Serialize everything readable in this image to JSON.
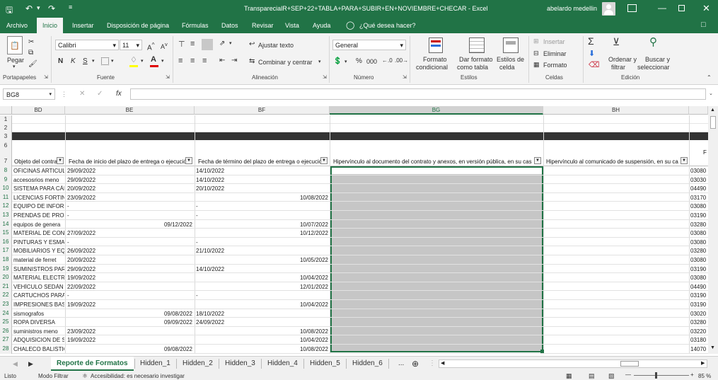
{
  "titlebar": {
    "save_icon": "save-icon",
    "undo_icon": "undo-icon",
    "redo_icon": "redo-icon",
    "customize_icon": "customize-qat-icon",
    "title": "TransparecialR+SEP+22+TABLA+PARA+SUBIR+EN+NOVIEMBRE+CHECAR  -  Excel",
    "user": "abelardo medellin",
    "ribbon_display_icon": "ribbon-display-icon",
    "minimize_icon": "minimize-icon",
    "restore_icon": "restore-icon",
    "close_icon": "close-icon"
  },
  "menu": {
    "items": [
      "Archivo",
      "Inicio",
      "Insertar",
      "Disposición de página",
      "Fórmulas",
      "Datos",
      "Revisar",
      "Vista",
      "Ayuda"
    ],
    "active": "Inicio",
    "tell_me": "¿Qué desea hacer?",
    "comments_icon": "comment-icon"
  },
  "ribbon": {
    "clipboard": {
      "paste": "Pegar",
      "label": "Portapapeles"
    },
    "font": {
      "name": "Calibri",
      "size": "11",
      "bold": "N",
      "italic": "K",
      "underline": "S",
      "label": "Fuente"
    },
    "alignment": {
      "wrap": "Ajustar texto",
      "merge": "Combinar y centrar",
      "label": "Alineación"
    },
    "number": {
      "format": "General",
      "percent": "%",
      "thousands": "000",
      "label": "Número"
    },
    "styles": {
      "conditional": [
        "Formato",
        "condicional"
      ],
      "table": [
        "Dar formato",
        "como tabla"
      ],
      "cell": [
        "Estilos de",
        "celda"
      ],
      "label": "Estilos"
    },
    "cells": {
      "insert": "Insertar",
      "delete": "Eliminar",
      "format": "Formato",
      "label": "Celdas"
    },
    "editing": {
      "sort": [
        "Ordenar y",
        "filtrar"
      ],
      "find": [
        "Buscar y",
        "seleccionar"
      ],
      "label": "Edición"
    }
  },
  "formula_bar": {
    "name_box": "BG8",
    "fx": "fx",
    "value": ""
  },
  "columns": [
    {
      "letter": "BD"
    },
    {
      "letter": "BE"
    },
    {
      "letter": "BF"
    },
    {
      "letter": "BG"
    },
    {
      "letter": "BH"
    }
  ],
  "header_row": {
    "row_number": "7",
    "cells": [
      "Objeto del contra",
      "Fecha de inicio del plazo de entrega o ejecució",
      "Fecha de término del plazo de entrega o ejecució",
      "Hipervínculo al documento del contrato y anexos, en versión pública, en su cas",
      "Hipervínculo al comunicado de suspensión, en su ca"
    ],
    "last_partial": "F"
  },
  "top_rows": [
    "1",
    "2",
    "3",
    "6"
  ],
  "rows": [
    {
      "n": "8",
      "bd": "OFICINAS ARTICULO",
      "be": "29/09/2022",
      "be_r": "",
      "bf": "14/10/2022",
      "bf_r": "",
      "bi": "03080"
    },
    {
      "n": "9",
      "bd": "accesosrios meno",
      "be": "29/09/2022",
      "be_r": "",
      "bf": "14/10/2022",
      "bf_r": "",
      "bi": "03030"
    },
    {
      "n": "10",
      "bd": "SISTEMA PARA CÁM",
      "be": "20/09/2022",
      "be_r": "",
      "bf": "20/10/2022",
      "bf_r": "",
      "bi": "04490"
    },
    {
      "n": "11",
      "bd": "LICENCIAS FORTINE",
      "be": "23/09/2022",
      "be_r": "",
      "bf": "",
      "bf_r": "10/08/2022",
      "bi": "03170"
    },
    {
      "n": "12",
      "bd": "EQUIPO DE INFORM",
      "be": "-",
      "be_r": "",
      "bf": "-",
      "bf_r": "",
      "bi": "03080"
    },
    {
      "n": "13",
      "bd": "PRENDAS DE PROTE",
      "be": "-",
      "be_r": "",
      "bf": "-",
      "bf_r": "",
      "bi": "03190"
    },
    {
      "n": "14",
      "bd": "equipos de genera",
      "be": "",
      "be_r": "09/12/2022",
      "bf": "",
      "bf_r": "10/07/2022",
      "bi": "03280"
    },
    {
      "n": "15",
      "bd": "MATERIAL DE CONS",
      "be": "27/09/2022",
      "be_r": "",
      "bf": "",
      "bf_r": "10/12/2022",
      "bi": "03080"
    },
    {
      "n": "16",
      "bd": "PINTURAS Y ESMAL",
      "be": "-",
      "be_r": "",
      "bf": "-",
      "bf_r": "",
      "bi": "03080"
    },
    {
      "n": "17",
      "bd": "MOBILIARIOS Y  EQ",
      "be": "26/09/2022",
      "be_r": "",
      "bf": "21/10/2022",
      "bf_r": "",
      "bi": "03280"
    },
    {
      "n": "18",
      "bd": "material de ferret",
      "be": "20/09/2022",
      "be_r": "",
      "bf": "",
      "bf_r": "10/05/2022",
      "bi": "03080"
    },
    {
      "n": "19",
      "bd": "SUMINISTROS PARA",
      "be": "29/09/2022",
      "be_r": "",
      "bf": "14/10/2022",
      "bf_r": "",
      "bi": "03190"
    },
    {
      "n": "20",
      "bd": "MATERIAL ELECTRIC",
      "be": "19/09/2022",
      "be_r": "",
      "bf": "",
      "bf_r": "10/04/2022",
      "bi": "03080"
    },
    {
      "n": "21",
      "bd": "VEHÍCULO SEDÁN",
      "be": "22/09/2022",
      "be_r": "",
      "bf": "",
      "bf_r": "12/01/2022",
      "bi": "04490"
    },
    {
      "n": "22",
      "bd": "CARTUCHOS PARA I",
      "be": "-",
      "be_r": "",
      "bf": "-",
      "bf_r": "",
      "bi": "03190"
    },
    {
      "n": "23",
      "bd": "IMPRESIONES BASI",
      "be": "19/09/2022",
      "be_r": "",
      "bf": "",
      "bf_r": "10/04/2022",
      "bi": "03190"
    },
    {
      "n": "24",
      "bd": "sismografos",
      "be": "",
      "be_r": "09/08/2022",
      "bf": "18/10/2022",
      "bf_r": "",
      "bi": "03020"
    },
    {
      "n": "25",
      "bd": "ROPA DIVERSA",
      "be": "",
      "be_r": "09/09/2022",
      "bf": "24/09/2022",
      "bf_r": "",
      "bi": "03280"
    },
    {
      "n": "26",
      "bd": "suministros meno",
      "be": "23/09/2022",
      "be_r": "",
      "bf": "",
      "bf_r": "10/08/2022",
      "bi": "03220"
    },
    {
      "n": "27",
      "bd": "ADQUISICION DE SI",
      "be": "19/09/2022",
      "be_r": "",
      "bf": "",
      "bf_r": "10/04/2022",
      "bi": "03180"
    },
    {
      "n": "28",
      "bd": "CHALECO BALISTICO",
      "be": "",
      "be_r": "09/08/2022",
      "bf": "",
      "bf_r": "10/08/2022",
      "bi": "14070"
    }
  ],
  "sheet_tabs": [
    "Reporte de Formatos",
    "Hidden_1",
    "Hidden_2",
    "Hidden_3",
    "Hidden_4",
    "Hidden_5",
    "Hidden_6"
  ],
  "active_tab": "Reporte de Formatos",
  "tab_more": "...",
  "status": {
    "ready": "Listo",
    "filter": "Modo Filtrar",
    "accessibility": "Accesibilidad: es necesario investigar",
    "zoom": "85 %"
  }
}
